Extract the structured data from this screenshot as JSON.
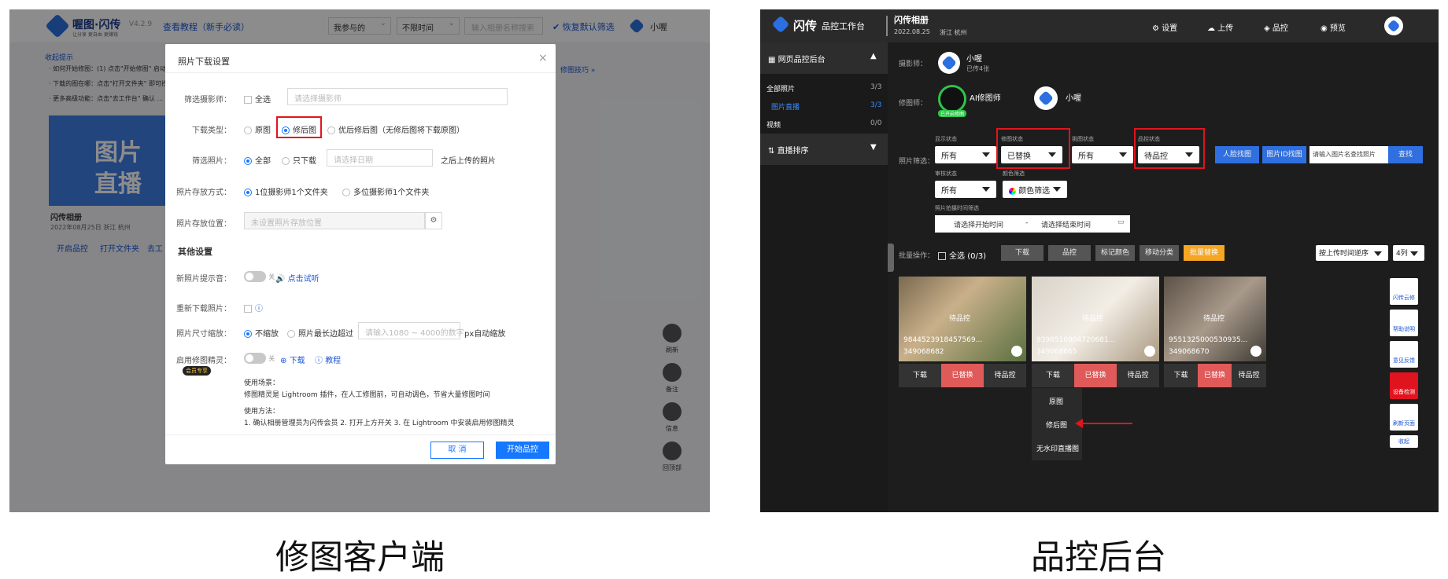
{
  "captions": {
    "left": "修图客户端",
    "right": "品控后台"
  },
  "left": {
    "header": {
      "app_name": "喔图·闪传",
      "tagline": "让分享 更自由 更赚钱",
      "version": "V4.2.9",
      "tutorial_link": "查看教程（新手必读）",
      "filter_mine": "我参与的",
      "filter_time": "不限时间",
      "search_placeholder": "输入相册名称搜索",
      "reset_filter": "恢复默认筛选",
      "user": "小喔"
    },
    "bg": {
      "tips_title": "收起提示",
      "tip1": "· 如何开始修图：(1) 点击\"开始修图\" 启动修...",
      "tip2": "· 下载的图在哪：点击\"打开文件夹\" 即可找...",
      "tip3": "· 更多高级功能：点击\"去工作台\" 确认 ...",
      "tips_link": "修图技巧 »",
      "album_title": "闪传相册",
      "album_meta": "2022年08月25日 浙江 杭州",
      "album_btn1": "开启品控",
      "album_btn2": "打开文件夹",
      "album_btn3": "去工",
      "cover_text1": "图片",
      "cover_text2": "直播",
      "watermark": "喔图",
      "side_refresh": "刷新",
      "side_notes": "备注",
      "side_info": "信息",
      "side_top": "回顶部"
    },
    "modal": {
      "title": "照片下载设置",
      "photographer_label": "筛选摄影师：",
      "select_all": "全选",
      "photographer_placeholder": "请选择摄影师",
      "download_type_label": "下载类型：",
      "type_original": "原图",
      "type_edited": "修后图",
      "type_fallback": "优后修后图（无修后图将下载原图）",
      "filter_label": "筛选照片：",
      "filter_all": "全部",
      "filter_only": "只下载",
      "date_placeholder": "请选择日期",
      "after_upload": "之后上传的照片",
      "storage_label": "照片存放方式：",
      "storage_one": "1位摄影师1个文件夹",
      "storage_multi": "多位摄影师1个文件夹",
      "location_label": "照片存放位置：",
      "location_placeholder": "未设置照片存放位置",
      "other_title": "其他设置",
      "sound_label": "新照片提示音：",
      "sound_off": "关",
      "sound_try": "点击试听",
      "redownload_label": "重新下载照片：",
      "resize_label": "照片尺寸缩放：",
      "resize_none": "不缩放",
      "resize_long": "照片最长边超过",
      "resize_placeholder": "请输入1080 ~ 4000的数字",
      "resize_suffix": "px自动缩放",
      "sprite_label": "启用修图精灵：",
      "sprite_off": "关",
      "sprite_download": "下载",
      "sprite_tutorial": "教程",
      "member_badge": "会员专享",
      "usage_title": "使用场景：",
      "usage_text": "修图精灵是 Lightroom 插件，在人工修图前，可自动调色，节省大量修图时间",
      "method_title": "使用方法：",
      "method_text": "1. 确认相册管理员为闪传会员  2. 打开上方开关  3. 在 Lightroom 中安装启用修图精灵",
      "cancel": "取 消",
      "start": "开始品控"
    }
  },
  "right": {
    "header": {
      "app_name": "闪传",
      "subtitle": "品控工作台",
      "album": "闪传相册",
      "date": "2022.08.25",
      "location": "浙江 杭州",
      "settings": "设置",
      "upload": "上传",
      "qc": "品控",
      "preview": "预览"
    },
    "sidebar": {
      "section": "网页品控后台",
      "all_photos": "全部照片",
      "all_count": "3/3",
      "live": "图片直播",
      "live_count": "3/3",
      "video": "视频",
      "video_count": "0/0",
      "sort": "直播排序"
    },
    "photographer": {
      "label": "摄影师：",
      "name": "小喔",
      "sub": "已传4张"
    },
    "retoucher": {
      "label": "修图师：",
      "ai_name": "AI修图师",
      "ai_badge": "已开启修图",
      "human_name": "小喔"
    },
    "filters": {
      "label": "照片筛选：",
      "display_label": "显示状态",
      "display_val": "所有",
      "edit_label": "修图状态",
      "edit_val": "已替换",
      "pick_label": "挑图状态",
      "pick_val": "所有",
      "qc_label": "品控状态",
      "qc_val": "待品控",
      "face_btn": "人脸找图",
      "id_btn": "图片ID找图",
      "name_placeholder": "请输入图片名查找照片",
      "find_btn": "查找",
      "review_label": "审核状态",
      "review_val": "所有",
      "color_label": "颜色筛选",
      "color_val": "颜色筛选",
      "time_label": "照片拍摄时间筛选",
      "start_time": "请选择开始时间",
      "dash": "-",
      "end_time": "请选择结束时间"
    },
    "batch": {
      "label": "批量操作：",
      "select_all": "全选",
      "count": "(0/3)",
      "download": "下载",
      "qc": "品控",
      "mark": "标记颜色",
      "move": "移动分类",
      "replace": "批量替换",
      "sort": "按上传时间逆序",
      "cols": "4列"
    },
    "photos": [
      {
        "id": "9844523918457569...",
        "code": "349068682",
        "status": "待品控"
      },
      {
        "id": "9398510804720681...",
        "code": "349068665",
        "status": "待品控"
      },
      {
        "id": "9551325000530935...",
        "code": "349068670",
        "status": "待品控"
      }
    ],
    "photo_actions": {
      "download": "下载",
      "replaced": "已替换",
      "pending": "待品控"
    },
    "dropdown": {
      "opt1": "原图",
      "opt2": "修后图",
      "opt3": "无水印直播图"
    },
    "tools": {
      "cloud": "闪传云修",
      "help": "帮助说明",
      "feedback": "意见反馈",
      "detect": "设备检测",
      "refresh": "刷新页面",
      "collapse": "收起"
    }
  }
}
